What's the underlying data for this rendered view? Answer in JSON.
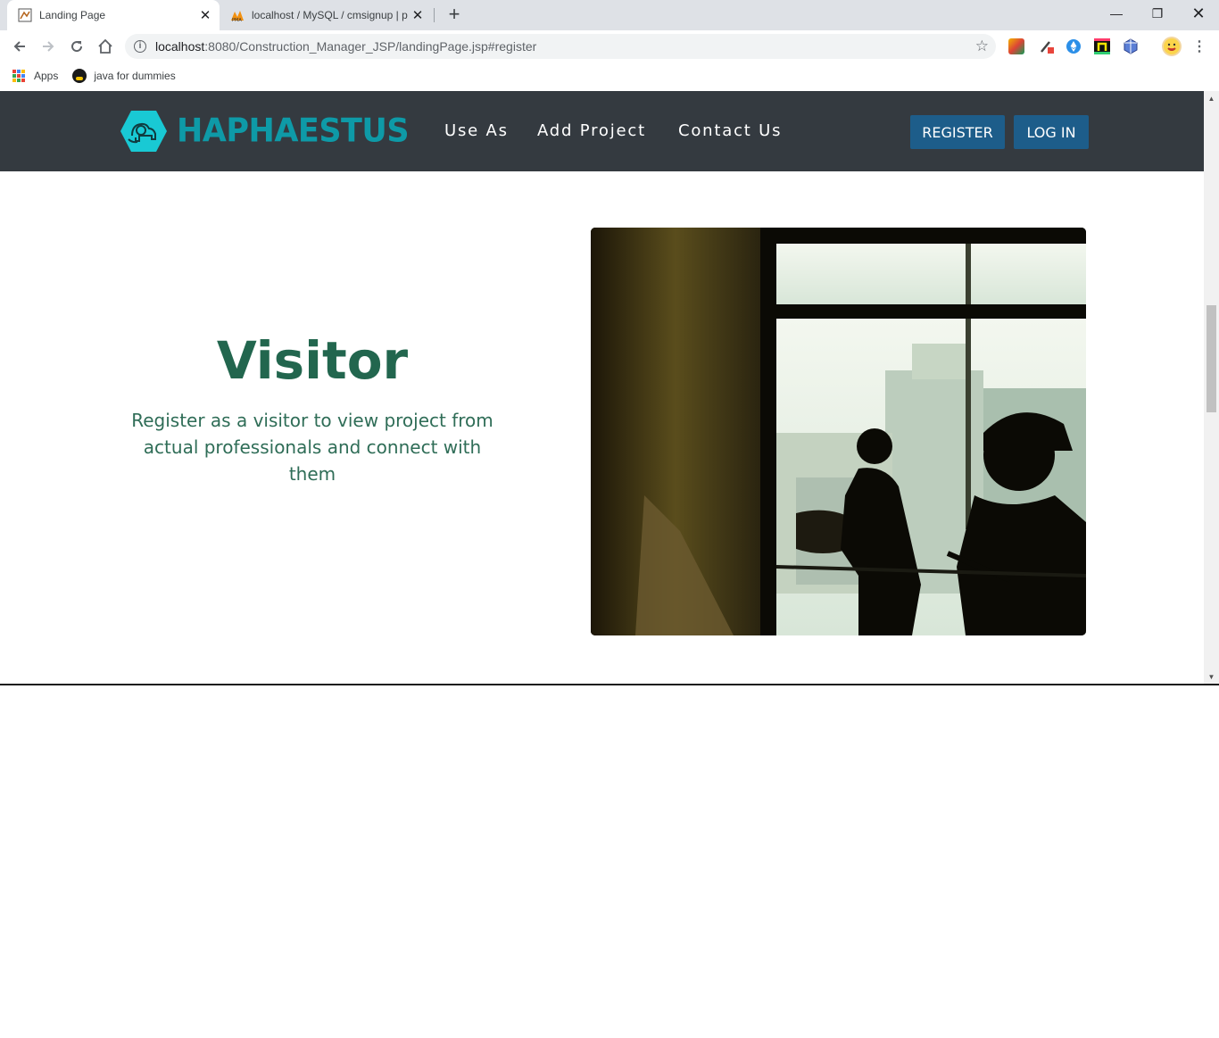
{
  "browser": {
    "tabs": [
      {
        "title": "Landing Page",
        "active": true
      },
      {
        "title": "localhost / MySQL / cmsignup | p",
        "active": false
      }
    ],
    "url": {
      "host": "localhost",
      "path": ":8080/Construction_Manager_JSP/landingPage.jsp#register"
    },
    "bookmarks": [
      {
        "label": "Apps",
        "icon": "apps-grid-icon"
      },
      {
        "label": "java for dummies",
        "icon": "penguin-icon"
      }
    ]
  },
  "site": {
    "brand": "HAPHAESTUS",
    "nav": {
      "use_as": "Use As",
      "add_project": "Add Project",
      "contact_us": "Contact Us"
    },
    "buttons": {
      "register": "REGISTER",
      "login": "LOG IN"
    },
    "colors": {
      "navbar": "#343a40",
      "brand": "#0e9aa7",
      "button": "#1d5d8a",
      "heading": "#22664e"
    }
  },
  "hero": {
    "title": "Visitor",
    "description": "Register as a visitor to view project from actual professionals and connect with them",
    "image": "construction-workers-silhouette-photo"
  }
}
